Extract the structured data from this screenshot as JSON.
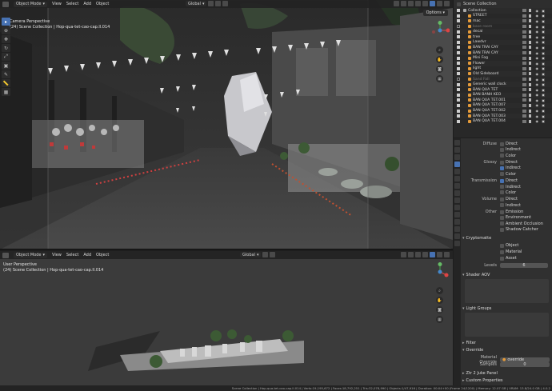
{
  "top_view": {
    "mode": "Object Mode",
    "menus": [
      "View",
      "Select",
      "Add",
      "Object"
    ],
    "transform": "Global",
    "options": "Options",
    "label_view": "Camera Perspective",
    "label_collection": "(24) Scene Collection | Hop-qua-tet-cao-cap.ll.014"
  },
  "bottom_view": {
    "mode": "Object Mode",
    "menus": [
      "View",
      "Select",
      "Add",
      "Object"
    ],
    "transform": "Global",
    "label_view": "User Perspective",
    "label_collection": "(24) Scene Collection | Hop-qua-tet-cao-cap.ll.014"
  },
  "outliner": {
    "title": "Scene Collection",
    "rows": [
      {
        "name": "Collection",
        "checked": true,
        "kind": "coll"
      },
      {
        "name": "STREET",
        "checked": true,
        "kind": "obj"
      },
      {
        "name": "mac",
        "checked": true,
        "kind": "obj"
      },
      {
        "name": "base room",
        "checked": false,
        "kind": "obj",
        "dim": true
      },
      {
        "name": "decal",
        "checked": true,
        "kind": "obj"
      },
      {
        "name": "tree",
        "checked": true,
        "kind": "obj"
      },
      {
        "name": "Lawdvr",
        "checked": true,
        "kind": "obj"
      },
      {
        "name": "BAN TRAI CAY",
        "checked": true,
        "kind": "obj"
      },
      {
        "name": "BAN TRAI CAY",
        "checked": true,
        "kind": "obj"
      },
      {
        "name": "Mini Fog",
        "checked": true,
        "kind": "obj"
      },
      {
        "name": "Flower",
        "checked": true,
        "kind": "obj"
      },
      {
        "name": "light",
        "checked": true,
        "kind": "obj"
      },
      {
        "name": "Old Sideboard",
        "checked": true,
        "kind": "obj"
      },
      {
        "name": "Sand Fall",
        "checked": false,
        "kind": "obj",
        "dim": true
      },
      {
        "name": "Generic wall clock",
        "checked": true,
        "kind": "obj"
      },
      {
        "name": "BAN QUA TET",
        "checked": true,
        "kind": "obj"
      },
      {
        "name": "BAN BANH KEO",
        "checked": true,
        "kind": "obj"
      },
      {
        "name": "BAN QUA TET.001",
        "checked": true,
        "kind": "obj"
      },
      {
        "name": "BAN QUA TET.007",
        "checked": true,
        "kind": "obj"
      },
      {
        "name": "BAN QUA TET.002",
        "checked": true,
        "kind": "obj"
      },
      {
        "name": "BAN QUA TET.003",
        "checked": true,
        "kind": "obj"
      },
      {
        "name": "BAN QUA TET.004",
        "checked": true,
        "kind": "obj"
      }
    ]
  },
  "properties": {
    "light_passes": [
      {
        "label": "Diffuse",
        "items": [
          {
            "t": "Direct",
            "on": false
          },
          {
            "t": "Indirect",
            "on": false
          },
          {
            "t": "Color",
            "on": false
          }
        ]
      },
      {
        "label": "Glossy",
        "items": [
          {
            "t": "Direct",
            "on": false
          },
          {
            "t": "Indirect",
            "on": true
          },
          {
            "t": "Color",
            "on": false
          }
        ]
      },
      {
        "label": "Transmission",
        "items": [
          {
            "t": "Direct",
            "on": true
          },
          {
            "t": "Indirect",
            "on": false
          },
          {
            "t": "Color",
            "on": false
          }
        ]
      },
      {
        "label": "Volume",
        "items": [
          {
            "t": "Direct",
            "on": false
          },
          {
            "t": "Indirect",
            "on": false
          }
        ]
      },
      {
        "label": "Other",
        "items": [
          {
            "t": "Emission",
            "on": false
          },
          {
            "t": "Environment",
            "on": false
          },
          {
            "t": "Ambient Occlusion",
            "on": false
          },
          {
            "t": "Shadow Catcher",
            "on": false
          }
        ]
      }
    ],
    "cryptomatte": {
      "title": "Cryptomatte",
      "items": [
        "Object",
        "Material",
        "Asset"
      ],
      "levels_label": "Levels",
      "levels_value": "6"
    },
    "shader_aov": "Shader AOV",
    "light_groups": "Light Groups",
    "filter": "Filter",
    "override": {
      "title": "Override",
      "material_label": "Material Override",
      "material_value": "override",
      "samples_label": "Samples",
      "samples_value": "0"
    },
    "grease_pencil": "Ztr 2 Juke Panel",
    "custom_props": "Custom Properties"
  },
  "status_bar": "Scene Collection | Hop-qua-tet-cao-cap.ll.014 | Verts:19,195,672 | Faces:18,792,251 | Tris:32,078,990 | Objects:1/47,916 | Duration: 00:04+00 (Frame 24/1200) | Memory: 12.07 GB | VRAM: 13.8/24.0 GB | 4.0.2",
  "colors": {
    "accent": "#4772b3",
    "orange": "#e59b3a",
    "panel": "#303030"
  }
}
